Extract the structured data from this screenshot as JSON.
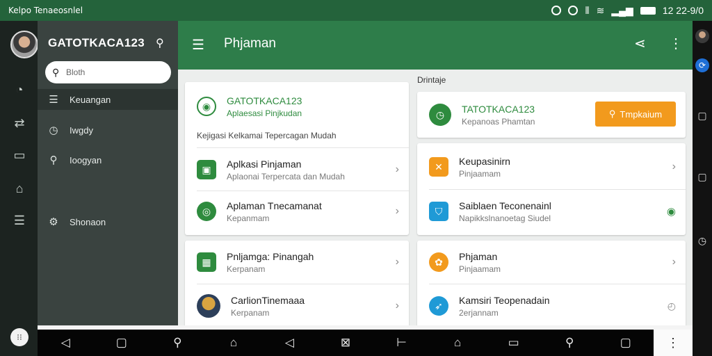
{
  "status_bar": {
    "title": "Kelpo Tenaeosnlel",
    "time": "12 22-9/0"
  },
  "drawer": {
    "username": "GATOTKACA123",
    "search_placeholder": "Bloth",
    "items": [
      {
        "label": "Keuangan",
        "icon": "list-icon"
      },
      {
        "label": "Iwgdy",
        "icon": "clock-icon"
      },
      {
        "label": "Ioogyan",
        "icon": "search-icon"
      },
      {
        "label": "Shonaon",
        "icon": "gear-icon"
      }
    ]
  },
  "app_bar": {
    "title": "Phjaman"
  },
  "left_cards": {
    "header": {
      "title": "GATOTKACA123",
      "subtitle": "Aplaesasi Pinjkudan",
      "tagline": "Kejigasi Kelkamai Tepercagan Mudah"
    },
    "rows": [
      {
        "title": "Aplkasi Pinjaman",
        "subtitle": "Aplaonai Terpercata dan Mudah",
        "color": "#2e8b3e"
      },
      {
        "title": "Aplaman Tnecamanat",
        "subtitle": "Kepanmam",
        "color": "#2e8b3e"
      },
      {
        "title": "Pnljamga: Pinangah",
        "subtitle": "Kerpanam",
        "color": "#2e8b3e"
      },
      {
        "title": "CarlionTinemaaa",
        "subtitle": "Kerpanam",
        "color": "#d9a441"
      }
    ]
  },
  "right_section": {
    "label": "Drintaje",
    "header": {
      "title": "TATOTKACA123",
      "subtitle": "Kepanoas Phamtan",
      "button": "Tmpkaium"
    },
    "rows": [
      {
        "title": "Keupasinirn",
        "subtitle": "Pinjaamam",
        "color": "#f29a1d"
      },
      {
        "title": "Saiblaen Teconenainl",
        "subtitle": "Napikkslnanoetag Siudel",
        "color": "#1f9ad6"
      },
      {
        "title": "Phjaman",
        "subtitle": "Pinjaamam",
        "color": "#f29a1d"
      },
      {
        "title": "Kamsiri Teopenadain",
        "subtitle": "2erjannam",
        "color": "#1f9ad6"
      }
    ]
  },
  "colors": {
    "app_bar": "#2e7d4a",
    "status_bar": "#24633b",
    "accent_orange": "#f29a1d",
    "green": "#2e8b3e"
  }
}
